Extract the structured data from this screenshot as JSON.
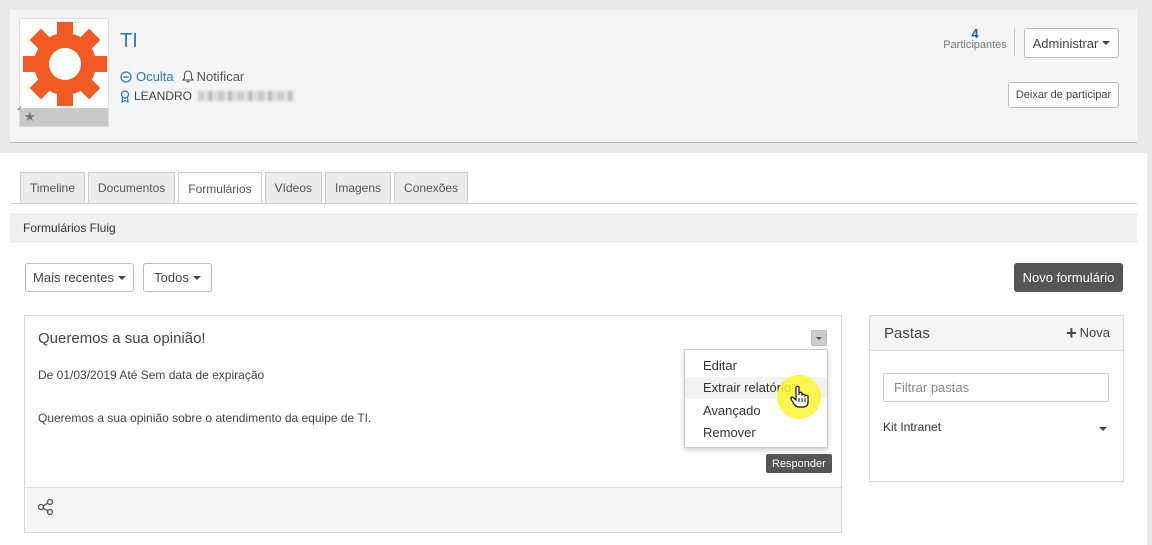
{
  "community": {
    "title": "TI",
    "visibility": "Oculta",
    "notify": "Notificar",
    "owner": "LEANDRO",
    "participants_count": "4",
    "participants_label": "Participantes",
    "admin_label": "Administrar",
    "leave_label": "Deixar de participar",
    "logo_color": "#f15a22"
  },
  "tabs": [
    {
      "label": "Timeline"
    },
    {
      "label": "Documentos"
    },
    {
      "label": "Formulários"
    },
    {
      "label": "Vídeos"
    },
    {
      "label": "Imagens"
    },
    {
      "label": "Conexões"
    }
  ],
  "section": {
    "title": "Formulários Fluig"
  },
  "toolbar": {
    "sort_label": "Mais recentes",
    "filter_label": "Todos",
    "new_form_label": "Novo formulário"
  },
  "form": {
    "title": "Queremos a sua opinião!",
    "dates": "De 01/03/2019 Até Sem data de expiração",
    "description": "Queremos a sua opinião sobre o atendimento da equipe de TI.",
    "respond_label": "Responder"
  },
  "menu": {
    "items": [
      {
        "label": "Editar"
      },
      {
        "label": "Extrair relatório"
      },
      {
        "label": "Avançado"
      },
      {
        "label": "Remover"
      }
    ]
  },
  "folders": {
    "title": "Pastas",
    "new_label": "Nova",
    "filter_placeholder": "Filtrar pastas",
    "items": [
      {
        "label": "Kit Intranet"
      }
    ]
  }
}
